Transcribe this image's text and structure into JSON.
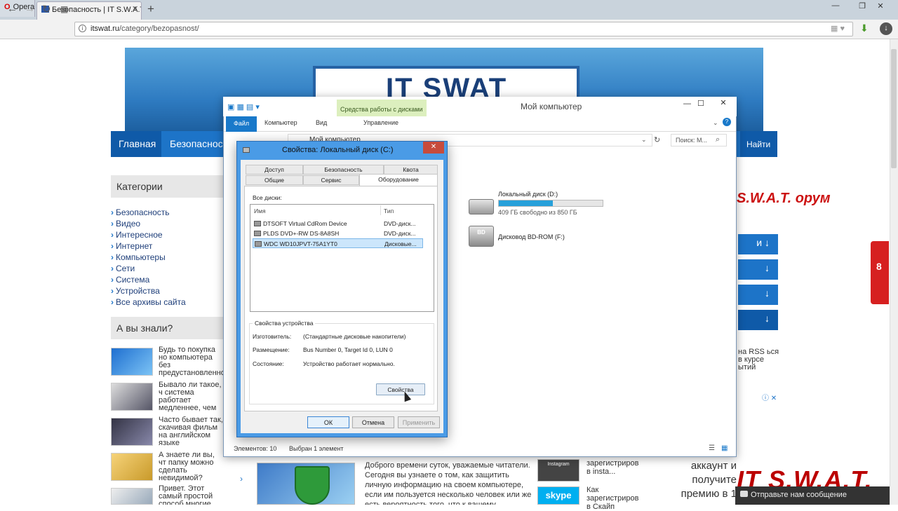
{
  "browser": {
    "menu_label": "Opera",
    "tab_title": "Безопасность | IT S.W.A.T",
    "url_domain": "itswat.ru",
    "url_path": "/category/bezopasnost/"
  },
  "site": {
    "banner_title": "IT SWAT",
    "nav": {
      "home": "Главная",
      "security": "Безопасност",
      "search": "Найти"
    },
    "categories_title": "Категории",
    "categories": [
      "Безопасность",
      "Видео",
      "Интересное",
      "Интернет",
      "Компьютеры",
      "Сети",
      "Система",
      "Устройства",
      "Все архивы сайта"
    ],
    "did_you_know_title": "А вы знали?",
    "articles": [
      "Будь то покупка но компьютера без предустановленно Windows ...",
      "Бывало ли такое, ч система работает медленнее, чем ва хотелось? ...",
      "Часто бывает так, скачивая фильм на английском языке большинстве ...",
      "А знаете ли вы, чт папку можно сделать невидимой? Интересно, ...",
      "Привет. Этот самый простой способ многие знают, а может и не"
    ],
    "right_logo": "S.W.A.T. орум",
    "right_rows": [
      "и",
      "",
      "",
      ""
    ],
    "rss_text": "на RSS ься в курсе ытий",
    "bottom_text": "Доброго времени суток, уважаемые читатели. Сегодня вы узнаете о том, как защитить личную информацию на своем компьютере, если им пользуется несколько человек или же есть вероятность того, что к вашему",
    "bottom_thumbs": [
      {
        "label": "зарегистриров в insta...",
        "thumb": "Instagram"
      },
      {
        "label": "Как зарегистриров в Скайп",
        "thumb": "skype"
      }
    ],
    "right_text": "аккаунт и получите премию в 1",
    "footer_logo": "IT S.W.A.T.",
    "message_button": "Отправьте нам сообщение",
    "red_tab": "8"
  },
  "explorer": {
    "title": "Мой компьютер",
    "context_tab": "Средства работы с дисками",
    "tabs": {
      "file": "Файл",
      "computer": "Компьютер",
      "view": "Вид",
      "manage": "Управление"
    },
    "address": "Мой компьютер",
    "search_placeholder": "Поиск: М...",
    "drive_d": {
      "name": "Локальный диск (D:)",
      "free": "409 ГБ свободно из 850 ГБ",
      "used_fraction": 0.52
    },
    "drive_f": {
      "name": "Дисковод BD-ROM (F:)",
      "badge": "BD"
    },
    "status_items": "Элементов: 10",
    "status_selected": "Выбран 1 элемент"
  },
  "dialog": {
    "title": "Свойства: Локальный диск (C:)",
    "tabs_row1": [
      "Доступ",
      "Безопасность",
      "Квота"
    ],
    "tabs_row2": [
      "Общие",
      "Сервис",
      "Оборудование"
    ],
    "all_disks_label": "Все диски:",
    "col_name": "Имя",
    "col_type": "Тип",
    "disks": [
      {
        "name": "DTSOFT Virtual CdRom Device",
        "type": "DVD-диск..."
      },
      {
        "name": "PLDS DVD+-RW DS-8A8SH",
        "type": "DVD-диск..."
      },
      {
        "name": "WDC WD10JPVT-75A1YT0",
        "type": "Дисковые..."
      }
    ],
    "props_title": "Свойства устройства",
    "manufacturer_label": "Изготовитель:",
    "manufacturer_value": "(Стандартные дисковые накопители)",
    "location_label": "Размещение:",
    "location_value": "Bus Number 0, Target Id 0, LUN 0",
    "state_label": "Состояние:",
    "state_value": "Устройство работает нормально.",
    "properties_button": "Свойства",
    "ok": "ОК",
    "cancel": "Отмена",
    "apply": "Применить"
  }
}
